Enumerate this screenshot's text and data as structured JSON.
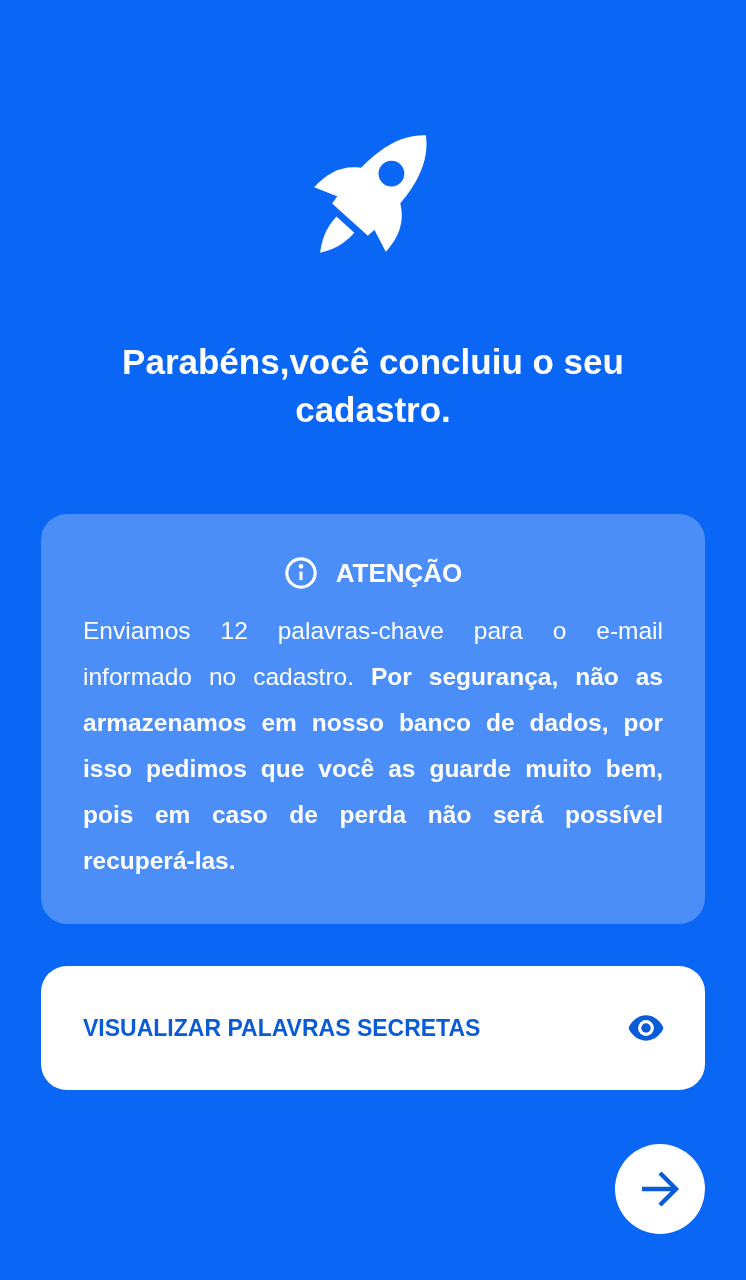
{
  "title": "Parabéns,você concluiu o seu cadastro.",
  "notice": {
    "heading": "ATENÇÃO",
    "text": "Enviamos 12 palavras-chave para o e-mail informado no cadastro. **Por segurança, não as armazenamos em nosso banco de dados, por isso pedimos que você as guarde muito bem, pois em caso de perda não será possível recuperá-las.**"
  },
  "reveal_button": {
    "label": "VISUALIZAR PALAVRAS SECRETAS"
  }
}
